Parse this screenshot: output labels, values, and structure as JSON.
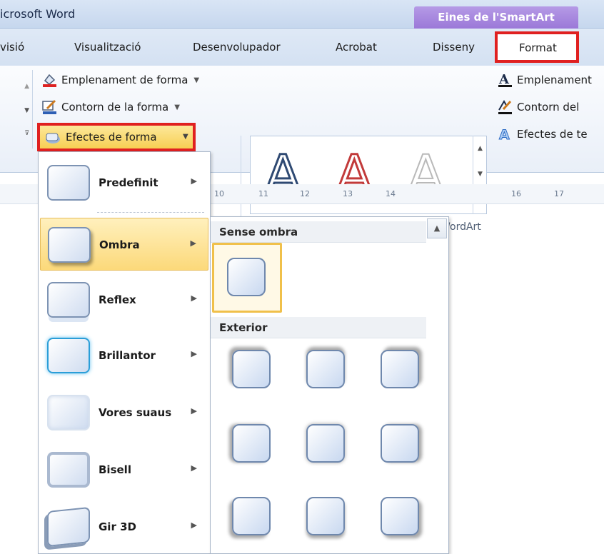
{
  "titlebar": {
    "app_title": "icrosoft Word",
    "context_tab": "Eines de l'SmartArt"
  },
  "tabs": [
    "visió",
    "Visualització",
    "Desenvolupador",
    "Acrobat",
    "Disseny",
    "Format"
  ],
  "ribbon": {
    "shape_styles": {
      "fill": "Emplenament de forma",
      "outline": "Contorn de la forma",
      "effects": "Efectes de forma"
    },
    "wordart": {
      "gallery_letters": [
        "A",
        "A",
        "A"
      ],
      "fill": "Emplenament",
      "outline": "Contorn del",
      "effects": "Efectes de te",
      "group_label": "Estils del WordArt"
    }
  },
  "ruler": [
    "10",
    "11",
    "12",
    "13",
    "14",
    "16",
    "17"
  ],
  "effects_menu": {
    "items": [
      {
        "label": "Predefinit"
      },
      {
        "label": "Ombra"
      },
      {
        "label": "Reflex"
      },
      {
        "label": "Brillantor"
      },
      {
        "label": "Vores suaus"
      },
      {
        "label": "Bisell"
      },
      {
        "label": "Gir 3D"
      }
    ]
  },
  "shadow_gallery": {
    "section_none": "Sense ombra",
    "section_outer": "Exterior"
  },
  "colors": {
    "highlight_red": "#e02020",
    "context_purple": "#9b78d8",
    "menu_hover": "#fcd97a"
  }
}
